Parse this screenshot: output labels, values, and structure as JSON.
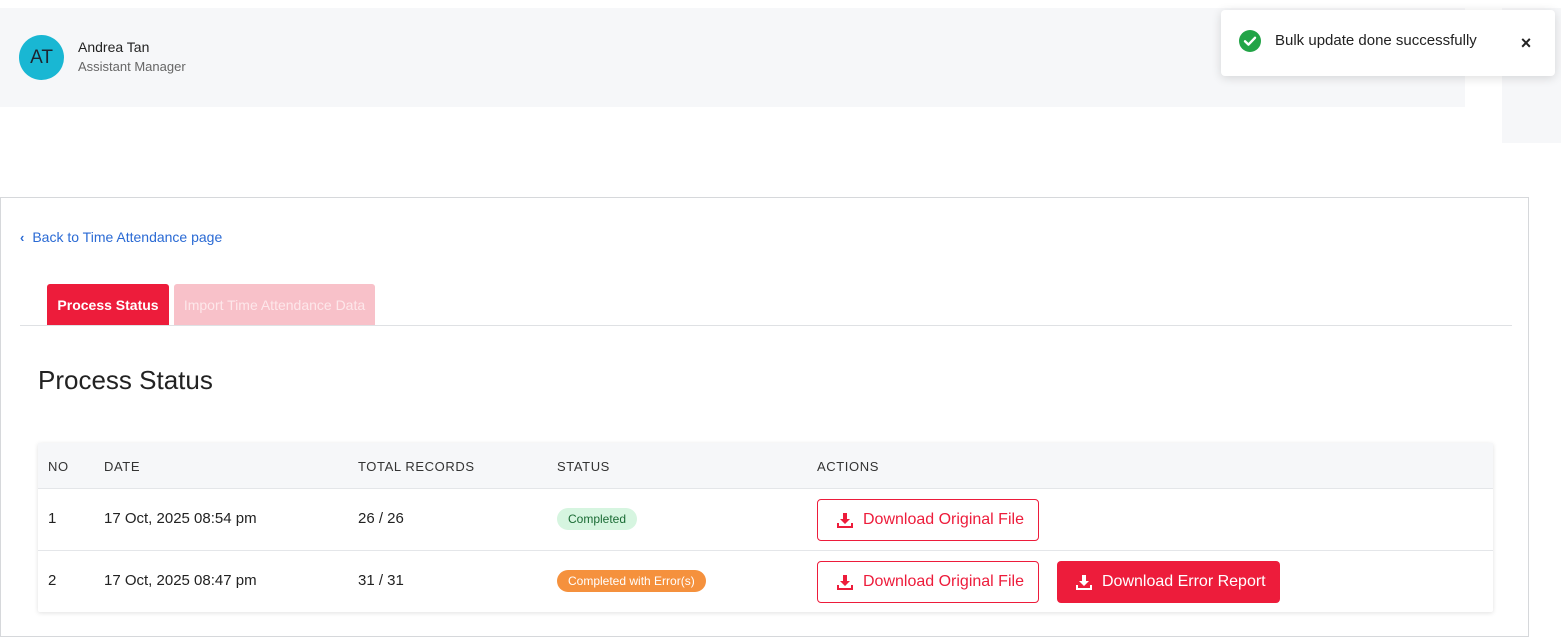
{
  "user": {
    "initials": "AT",
    "name": "Andrea Tan",
    "role": "Assistant Manager"
  },
  "toast": {
    "message": "Bulk update done successfully",
    "close_label": "×",
    "icon": "check-circle-icon",
    "icon_color": "#22a447"
  },
  "nav": {
    "back_label": "Back to Time Attendance page"
  },
  "tabs": [
    {
      "label": "Process Status",
      "active": true
    },
    {
      "label": "Import Time Attendance Data",
      "active": false
    }
  ],
  "section": {
    "title": "Process Status"
  },
  "table": {
    "columns": [
      "NO",
      "DATE",
      "TOTAL RECORDS",
      "STATUS",
      "ACTIONS"
    ],
    "rows": [
      {
        "no": "1",
        "date": "17 Oct, 2025 08:54 pm",
        "total": "26 / 26",
        "status": "Completed",
        "actions": [
          "Download Original File"
        ]
      },
      {
        "no": "2",
        "date": "17 Oct, 2025 08:47 pm",
        "total": "31 / 31",
        "status": "Completed with Error(s)",
        "actions": [
          "Download Original File",
          "Download Error Report"
        ]
      }
    ]
  },
  "colors": {
    "accent": "#ed1c3b",
    "avatar": "#19b7d3",
    "link": "#2a6ad4",
    "status_ok_bg": "#d6f5e0",
    "status_error_bg": "#f5913d"
  }
}
